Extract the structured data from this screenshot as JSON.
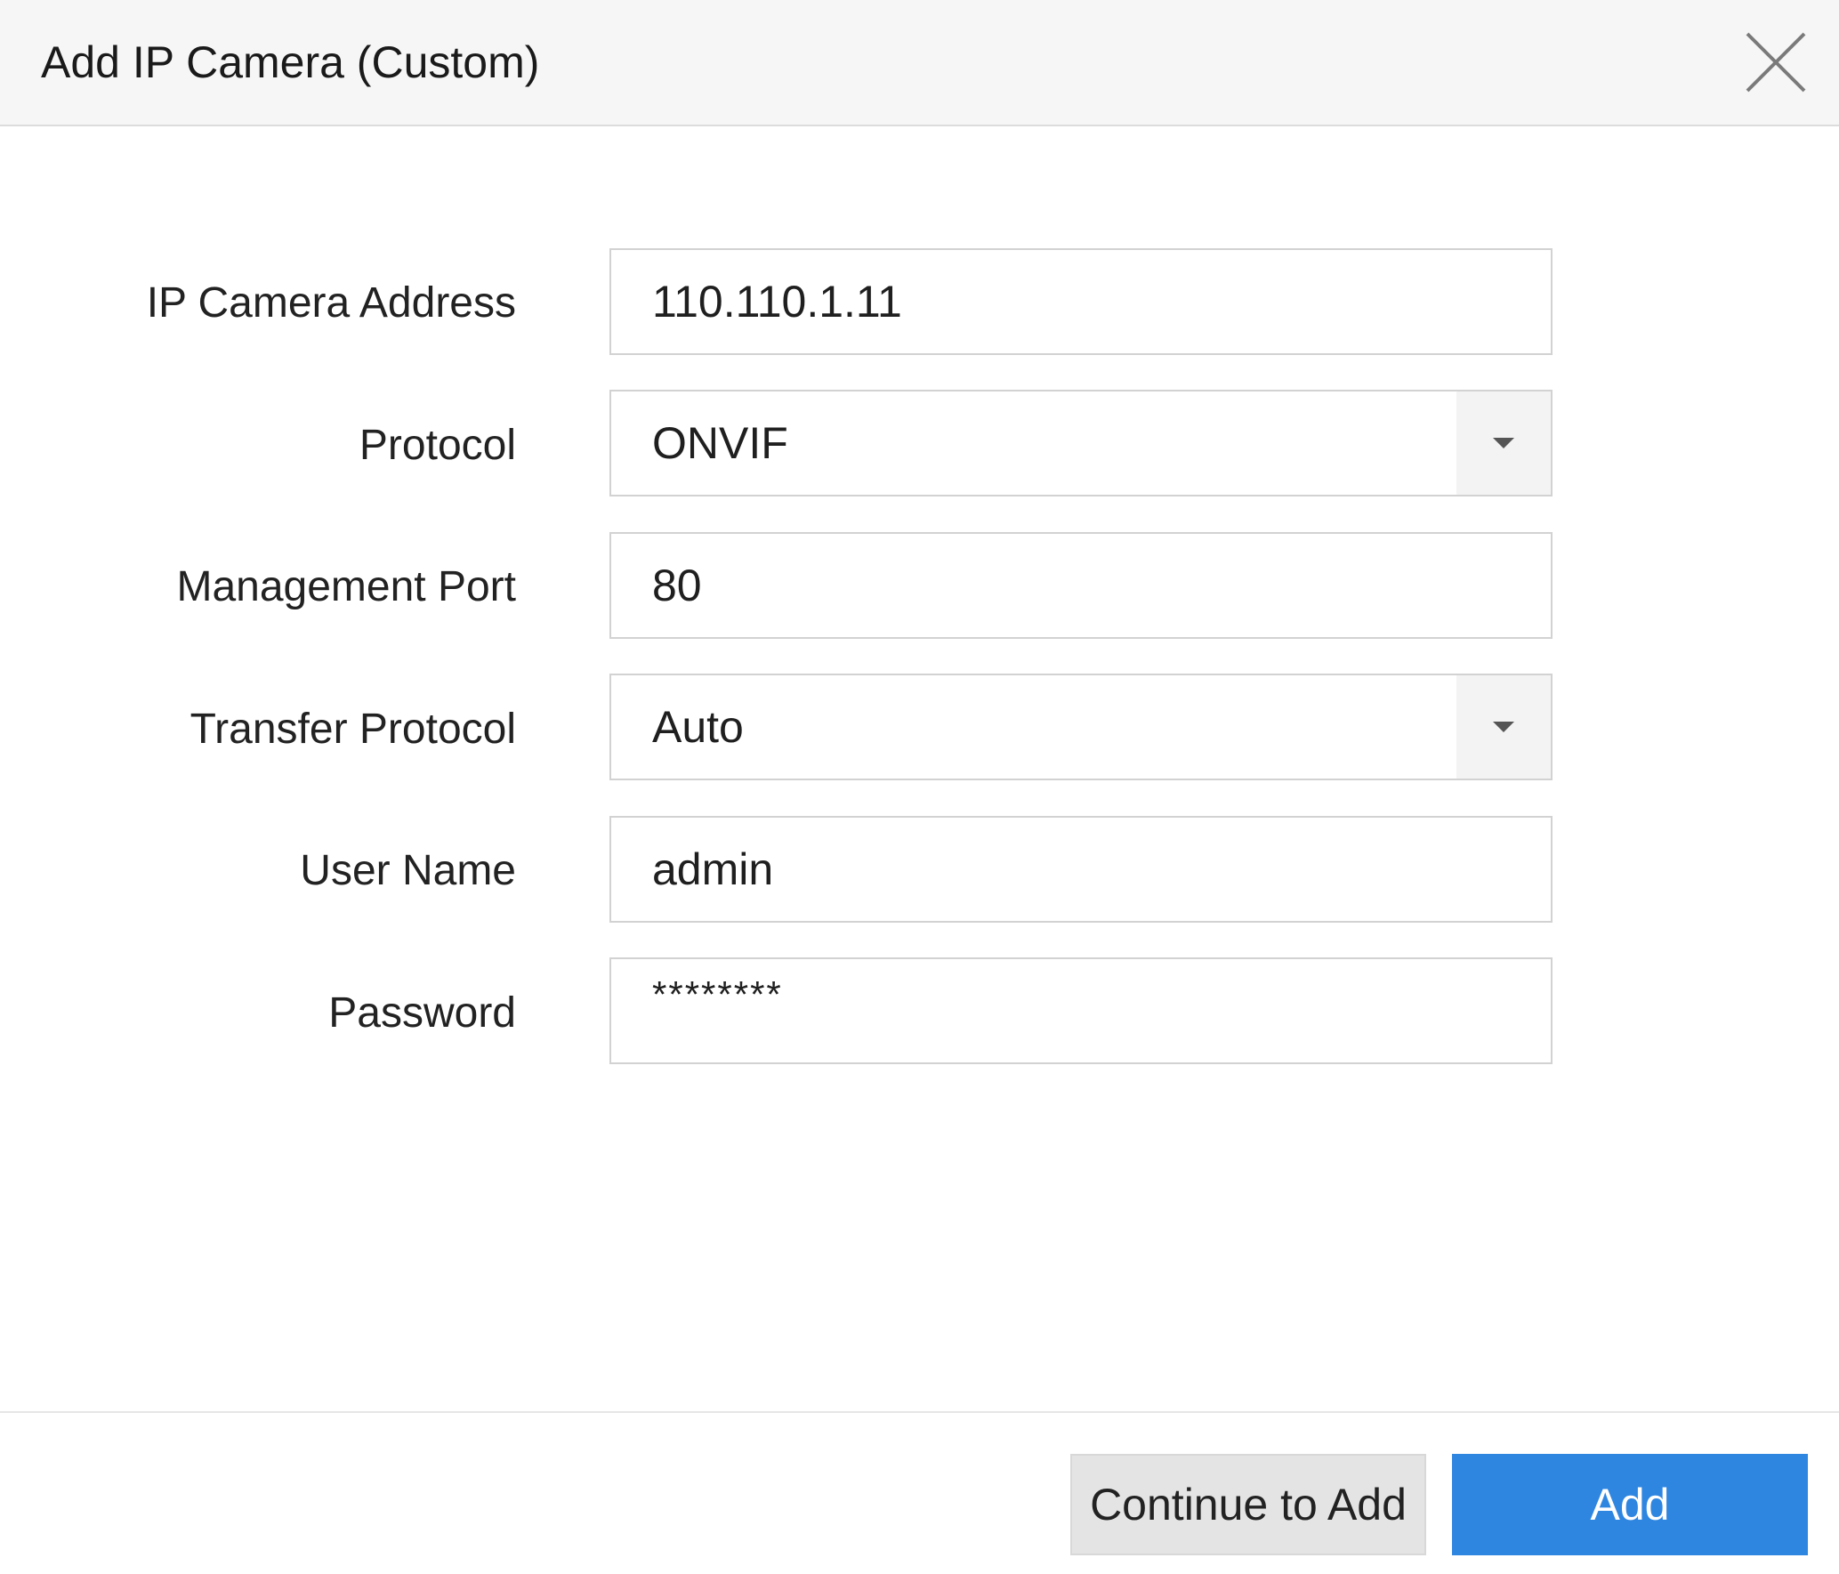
{
  "dialog": {
    "title": "Add IP Camera (Custom)",
    "close_icon": "close-icon"
  },
  "form": {
    "ip_camera_address": {
      "label": "IP Camera Address",
      "value": "110.110.1.11"
    },
    "protocol": {
      "label": "Protocol",
      "value": "ONVIF",
      "icon": "chevron-down-icon"
    },
    "management_port": {
      "label": "Management Port",
      "value": "80"
    },
    "transfer_protocol": {
      "label": "Transfer Protocol",
      "value": "Auto",
      "icon": "chevron-down-icon"
    },
    "user_name": {
      "label": "User Name",
      "value": "admin"
    },
    "password": {
      "label": "Password",
      "value": "********"
    }
  },
  "footer": {
    "continue_label": "Continue to Add",
    "add_label": "Add"
  },
  "colors": {
    "primary": "#2f86e0",
    "secondary": "#e4e4e4",
    "title_bar": "#f6f6f6"
  }
}
